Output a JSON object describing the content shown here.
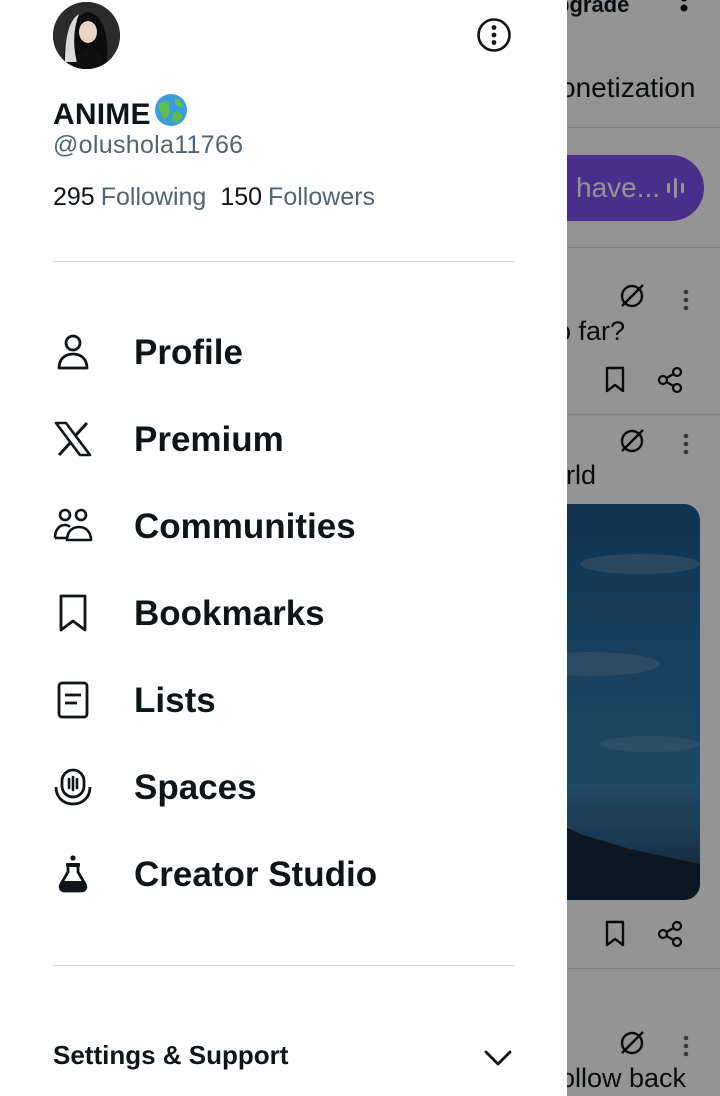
{
  "drawer": {
    "display_name": "ANIME",
    "handle": "@olushola11766",
    "following_count": "295",
    "following_label": "Following",
    "followers_count": "150",
    "followers_label": "Followers",
    "nav_items": [
      {
        "label": "Profile",
        "icon": "person-icon"
      },
      {
        "label": "Premium",
        "icon": "x-logo-icon"
      },
      {
        "label": "Communities",
        "icon": "communities-icon"
      },
      {
        "label": "Bookmarks",
        "icon": "bookmark-icon"
      },
      {
        "label": "Lists",
        "icon": "list-icon"
      },
      {
        "label": "Spaces",
        "icon": "spaces-icon"
      },
      {
        "label": "Creator Studio",
        "icon": "flask-icon"
      }
    ],
    "settings_label": "Settings & Support"
  },
  "feed": {
    "header_fragment": "pgrade",
    "tab_fragment": "onetization",
    "spaces_pill_text": "have...",
    "post1_text": "o far?",
    "post2_text": "rld",
    "post3_text": "ollow back"
  },
  "colors": {
    "text_primary": "#0f1419",
    "text_secondary": "#536471",
    "spaces_purple": "#7c52f0",
    "divider": "#cfd9de"
  }
}
